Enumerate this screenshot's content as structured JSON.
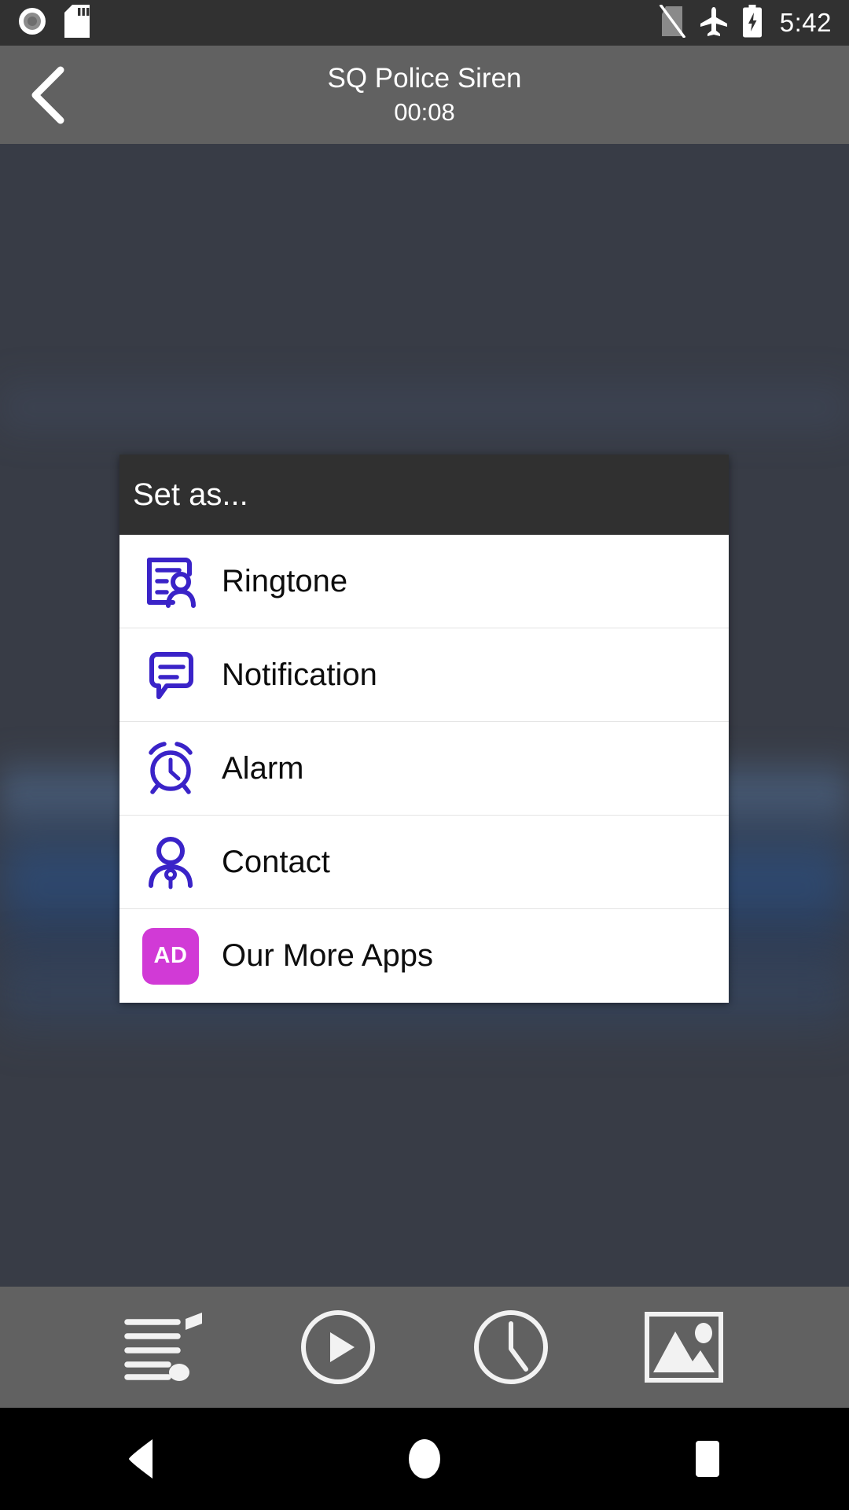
{
  "status_bar": {
    "time": "5:42",
    "icons": [
      {
        "name": "recording-disc-icon"
      },
      {
        "name": "sd-card-icon"
      },
      {
        "name": "no-sim-icon"
      },
      {
        "name": "airplane-mode-icon"
      },
      {
        "name": "battery-charging-icon"
      }
    ]
  },
  "header": {
    "back_icon": "back-chevron-icon",
    "title": "SQ Police Siren",
    "duration": "00:08"
  },
  "dialog": {
    "title": "Set as...",
    "items": [
      {
        "label": "Ringtone",
        "icon": "ringtone-contact-card-icon"
      },
      {
        "label": "Notification",
        "icon": "speech-bubble-icon"
      },
      {
        "label": "Alarm",
        "icon": "alarm-clock-icon"
      },
      {
        "label": "Contact",
        "icon": "contact-person-icon"
      },
      {
        "label": "Our More Apps",
        "icon": "ad-badge-icon",
        "badge_text": "AD"
      }
    ]
  },
  "toolbar": {
    "items": [
      {
        "name": "playlist-music-icon",
        "label": "Playlist"
      },
      {
        "name": "play-circle-icon",
        "label": "Play"
      },
      {
        "name": "clock-icon",
        "label": "Timer"
      },
      {
        "name": "gallery-image-icon",
        "label": "Gallery"
      }
    ]
  },
  "nav_bar": {
    "items": [
      {
        "name": "android-back-icon",
        "label": "Back"
      },
      {
        "name": "android-home-icon",
        "label": "Home"
      },
      {
        "name": "android-recents-icon",
        "label": "Recents"
      }
    ]
  },
  "colors": {
    "status_bar": "#313131",
    "header": "#616161",
    "wallpaper": "#383c46",
    "dialog_header": "#303030",
    "dialog_body": "#ffffff",
    "icon_purple": "#3a23c8",
    "ad_magenta": "#d13ad6",
    "toolbar": "#616161",
    "nav_bar": "#000000"
  }
}
